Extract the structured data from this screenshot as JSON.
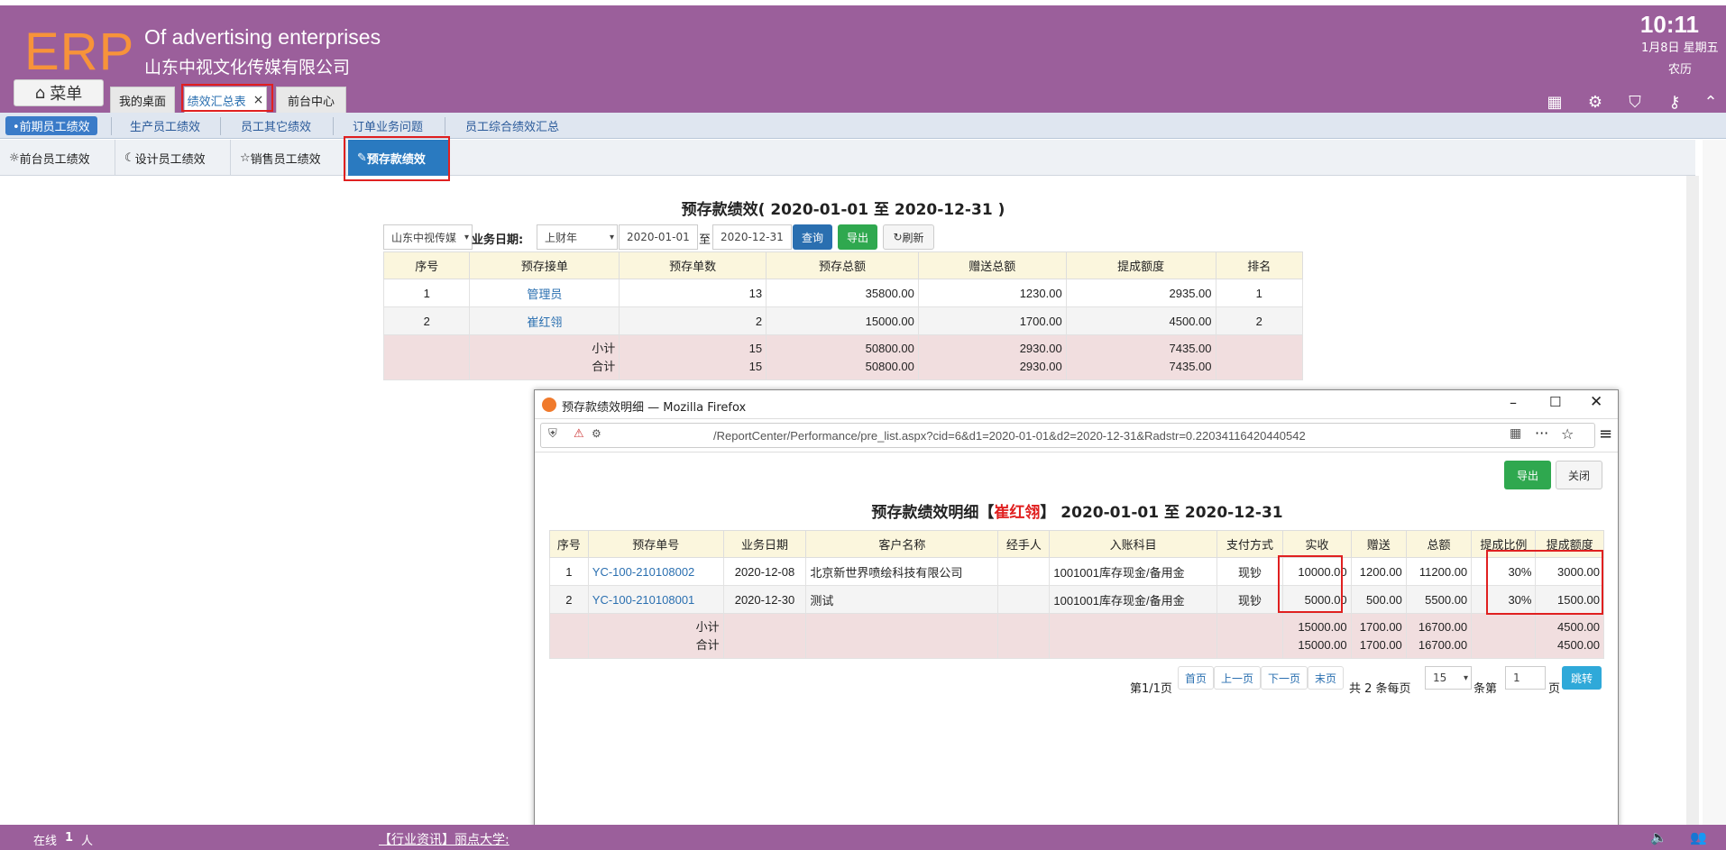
{
  "header": {
    "logo": "ERP",
    "enterprise_en": "Of advertising enterprises",
    "enterprise_cn": "山东中视文化传媒有限公司",
    "time": "10:11",
    "date": "1月8日 星期五",
    "lunar": "农历",
    "menu_label": "菜单",
    "tabs": [
      {
        "label": "我的桌面"
      },
      {
        "label": "绩效汇总表"
      },
      {
        "label": "前台中心"
      }
    ],
    "close_glyph": "×",
    "icons": [
      "grid-icon",
      "gear-icon",
      "shirt-icon",
      "key-icon",
      "up-icon"
    ]
  },
  "subnav1": {
    "items": [
      {
        "label": "•前期员工绩效"
      },
      {
        "label": "生产员工绩效"
      },
      {
        "label": "员工其它绩效"
      },
      {
        "label": "订单业务问题"
      },
      {
        "label": "员工综合绩效汇总"
      }
    ]
  },
  "subnav2": {
    "items": [
      {
        "icon": "☼",
        "label": "前台员工绩效"
      },
      {
        "icon": "☾",
        "label": "设计员工绩效"
      },
      {
        "icon": "☆",
        "label": "销售员工绩效"
      },
      {
        "icon": "✎",
        "label": "预存款绩效"
      }
    ]
  },
  "report": {
    "title": "预存款绩效( 2020-01-01 至 2020-12-31 )",
    "company_select": "山东中视传媒",
    "date_label": "业务日期:",
    "period_select": "上财年",
    "date_from": "2020-01-01",
    "to_label": "至",
    "date_to": "2020-12-31",
    "query_btn": "查询",
    "export_btn": "导出",
    "refresh_btn": "刷新",
    "columns": [
      "序号",
      "预存接单",
      "预存单数",
      "预存总额",
      "赠送总额",
      "提成额度",
      "排名"
    ],
    "rows": [
      {
        "no": "1",
        "name": "管理员",
        "count": "13",
        "total": "35800.00",
        "gift": "1230.00",
        "commission": "2935.00",
        "rank": "1"
      },
      {
        "no": "2",
        "name": "崔红翎",
        "count": "2",
        "total": "15000.00",
        "gift": "1700.00",
        "commission": "4500.00",
        "rank": "2"
      }
    ],
    "subtotal": {
      "label": "小计",
      "count": "15",
      "total": "50800.00",
      "gift": "2930.00",
      "commission": "7435.00"
    },
    "grandtotal": {
      "label": "合计",
      "count": "15",
      "total": "50800.00",
      "gift": "2930.00",
      "commission": "7435.00"
    }
  },
  "popup": {
    "window_title": "预存款绩效明细 — Mozilla Firefox",
    "url": "/ReportCenter/Performance/pre_list.aspx?cid=6&d1=2020-01-01&d2=2020-12-31&Radstr=0.22034116420440542",
    "export_btn": "导出",
    "close_btn": "关闭",
    "title_prefix": "预存款绩效明细【",
    "title_name": "崔红翎",
    "title_suffix": "】 2020-01-01 至 2020-12-31",
    "columns": [
      "序号",
      "预存单号",
      "业务日期",
      "客户名称",
      "经手人",
      "入账科目",
      "支付方式",
      "实收",
      "赠送",
      "总额",
      "提成比例",
      "提成额度"
    ],
    "rows": [
      {
        "no": "1",
        "order": "YC-100-210108002",
        "date": "2020-12-08",
        "customer": "北京新世界喷绘科技有限公司",
        "handler": "",
        "account": "1001001库存现金/备用金",
        "pay": "现钞",
        "received": "10000.00",
        "gift": "1200.00",
        "total": "11200.00",
        "ratio": "30%",
        "commission": "3000.00"
      },
      {
        "no": "2",
        "order": "YC-100-210108001",
        "date": "2020-12-30",
        "customer": "测试",
        "handler": "",
        "account": "1001001库存现金/备用金",
        "pay": "现钞",
        "received": "5000.00",
        "gift": "500.00",
        "total": "5500.00",
        "ratio": "30%",
        "commission": "1500.00"
      }
    ],
    "subtotal": {
      "label": "小计",
      "received": "15000.00",
      "gift": "1700.00",
      "total": "16700.00",
      "commission": "4500.00"
    },
    "grandtotal": {
      "label": "合计",
      "received": "15000.00",
      "gift": "1700.00",
      "total": "16700.00",
      "commission": "4500.00"
    },
    "pager": {
      "page_info": "第1/1页",
      "first": "首页",
      "prev": "上一页",
      "next": "下一页",
      "last": "末页",
      "total_info": "共 2 条每页",
      "page_size": "15",
      "goto_prefix": "条第",
      "goto_page": "1",
      "goto_suffix": "页",
      "goto_btn": "跳转"
    }
  },
  "footer": {
    "online_prefix": "在线",
    "online_count": "1",
    "online_suffix": "人",
    "news": "【行业资讯】丽点大学:"
  },
  "colors": {
    "header_bg": "#9b5f9b",
    "logo": "#f7933a",
    "accent": "#2a7ac0",
    "highlight_box": "#e02020"
  }
}
